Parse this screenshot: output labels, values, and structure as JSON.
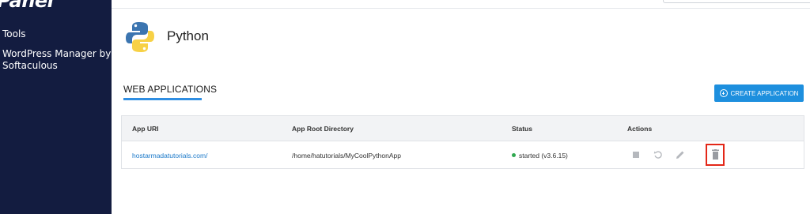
{
  "sidebar": {
    "logo_text": "Panel",
    "items": [
      {
        "label": "Tools"
      },
      {
        "label": "WordPress Manager by"
      },
      {
        "label": "Softaculous"
      }
    ]
  },
  "page": {
    "title": "Python",
    "section_title": "WEB APPLICATIONS",
    "create_button_label": "CREATE APPLICATION"
  },
  "table": {
    "headers": [
      "App URI",
      "App Root Directory",
      "Status",
      "Actions"
    ],
    "rows": [
      {
        "uri": "hostarmadatutorials.com/",
        "root": "/home/hatutorials/MyCoolPythonApp",
        "status": "started (v3.6.15)",
        "status_color": "#2fa84f"
      }
    ],
    "actions": [
      "stop-icon",
      "restart-icon",
      "edit-icon",
      "delete-icon"
    ]
  },
  "colors": {
    "sidebar_bg": "#131c40",
    "accent": "#1d8fde",
    "highlight": "#e32718"
  }
}
